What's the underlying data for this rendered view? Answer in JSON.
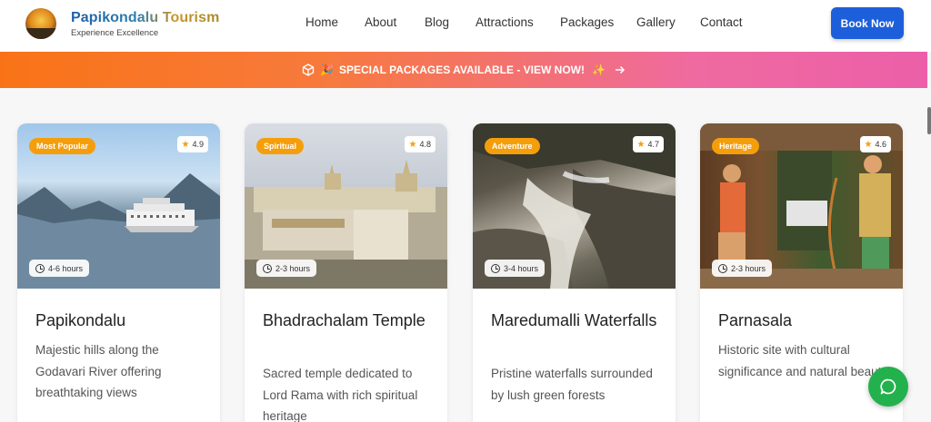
{
  "header": {
    "brand_title": "Papikondalu Tourism",
    "brand_subtitle": "Experience Excellence",
    "nav": [
      "Home",
      "About",
      "Blog",
      "Attractions",
      "Packages",
      "Gallery",
      "Contact"
    ],
    "book_label": "Book Now"
  },
  "banner": {
    "text": "SPECIAL PACKAGES AVAILABLE - VIEW NOW!",
    "left_icons": [
      "cube-icon",
      "sparkles-icon"
    ],
    "right_icons": [
      "sparkle-icon",
      "arrow-right-icon"
    ]
  },
  "cards": [
    {
      "badge": "Most Popular",
      "rating": "4.9",
      "duration": "4-6 hours",
      "title": "Papikondalu",
      "description": "Majestic hills along the Godavari River offering breathtaking views"
    },
    {
      "badge": "Spiritual",
      "rating": "4.8",
      "duration": "2-3 hours",
      "title": "Bhadrachalam Temple",
      "description": "Sacred temple dedicated to Lord Rama with rich spiritual heritage"
    },
    {
      "badge": "Adventure",
      "rating": "4.7",
      "duration": "3-4 hours",
      "title": "Maredumalli Waterfalls",
      "description": "Pristine waterfalls surrounded by lush green forests"
    },
    {
      "badge": "Heritage",
      "rating": "4.6",
      "duration": "2-3 hours",
      "title": "Parnasala",
      "description": "Historic site with cultural significance and natural beauty"
    }
  ],
  "colors": {
    "accent": "#1d5fdb",
    "badge": "#f59e0b",
    "chat": "#22b14c"
  }
}
